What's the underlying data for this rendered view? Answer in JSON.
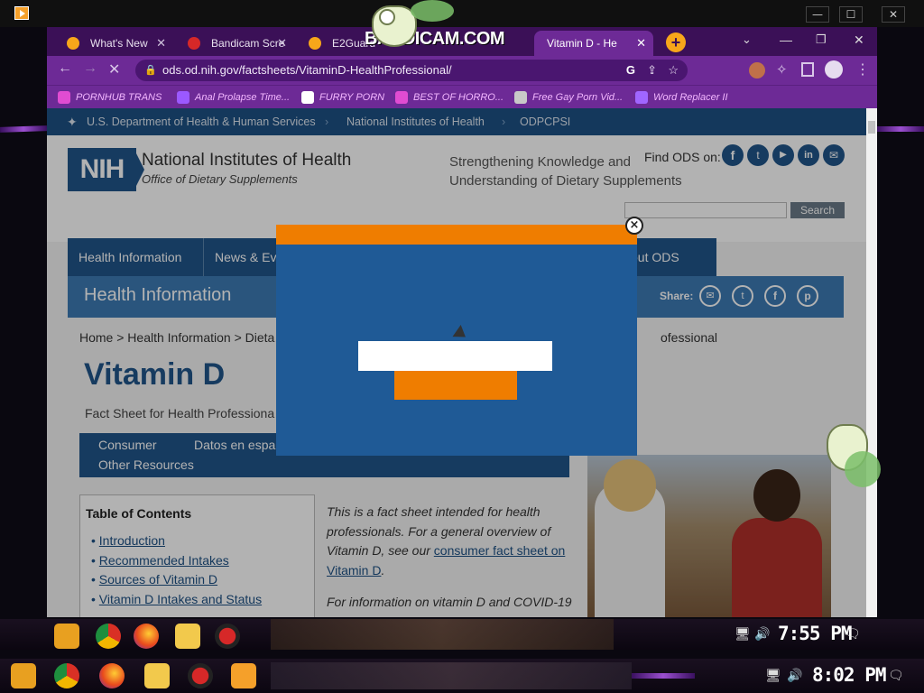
{
  "browser": {
    "tabs": [
      {
        "label": "What's New",
        "icon_color": "#f7a61a"
      },
      {
        "label": "Bandicam Scre",
        "icon_color": "#d62828"
      },
      {
        "label": "E2Guard",
        "icon_color": "#f7a61a"
      },
      {
        "label": "Vitamin D - He",
        "icon_color": "#1e5185",
        "active": true
      }
    ],
    "watermark": "BANDICAM.COM",
    "url": "ods.od.nih.gov/factsheets/VitaminD-HealthProfessional/",
    "bookmarks": [
      {
        "label": "PORNHUB TRANS",
        "icon_color": "#e14cd2"
      },
      {
        "label": "Anal Prolapse Time...",
        "icon_color": "#9b59ff"
      },
      {
        "label": "FURRY PORN",
        "icon_color": "#ffffff"
      },
      {
        "label": "BEST OF HORRO...",
        "icon_color": "#e14cd2"
      },
      {
        "label": "Free Gay Porn Vid...",
        "icon_color": "#c8c8c8"
      },
      {
        "label": "Word Replacer II",
        "icon_color": "#a066ff"
      }
    ]
  },
  "site": {
    "hhs_links": [
      "U.S. Department of Health & Human Services",
      "National Institutes of Health",
      "ODPCPSI"
    ],
    "logo_text": "NIH",
    "org_name": "National Institutes of Health",
    "org_sub": "Office of Dietary Supplements",
    "tagline_1": "Strengthening Knowledge and",
    "tagline_2": "Understanding of Dietary Supplements",
    "find_ods": "Find ODS on:",
    "search_button": "Search",
    "nav": [
      "Health Information",
      "News & Ev",
      "out ODS"
    ],
    "section_title": "Health Information",
    "share_label": "Share:",
    "breadcrumb": "Home > Health Information > Dieta",
    "breadcrumb_tail": "ofessional",
    "page_title": "Vitamin D",
    "page_subtitle": "Fact Sheet for Health Professiona",
    "lang_tabs": [
      "Consumer",
      "Datos en españ",
      "Other Resources"
    ],
    "toc_title": "Table of Contents",
    "toc_items": [
      "Introduction",
      "Recommended Intakes",
      "Sources of Vitamin D",
      "Vitamin D Intakes and Status"
    ],
    "intro_lines": [
      "This is a fact sheet intended for health",
      "professionals. For a general overview of",
      "Vitamin D, see our"
    ],
    "intro_link_1": "consumer fact sheet on",
    "intro_link_2": "Vitamin D",
    "intro_end": ".",
    "covid_line": "For information on vitamin D and COVID-19"
  },
  "modal": {
    "close_glyph": "×",
    "input_value": "",
    "submit_label": ""
  },
  "taskbar_inner": {
    "time": "7:55 PM"
  },
  "taskbar_outer": {
    "time": "8:02 PM"
  },
  "window_controls": {
    "minimize": "—",
    "maximize": "☐",
    "close": "✕"
  }
}
